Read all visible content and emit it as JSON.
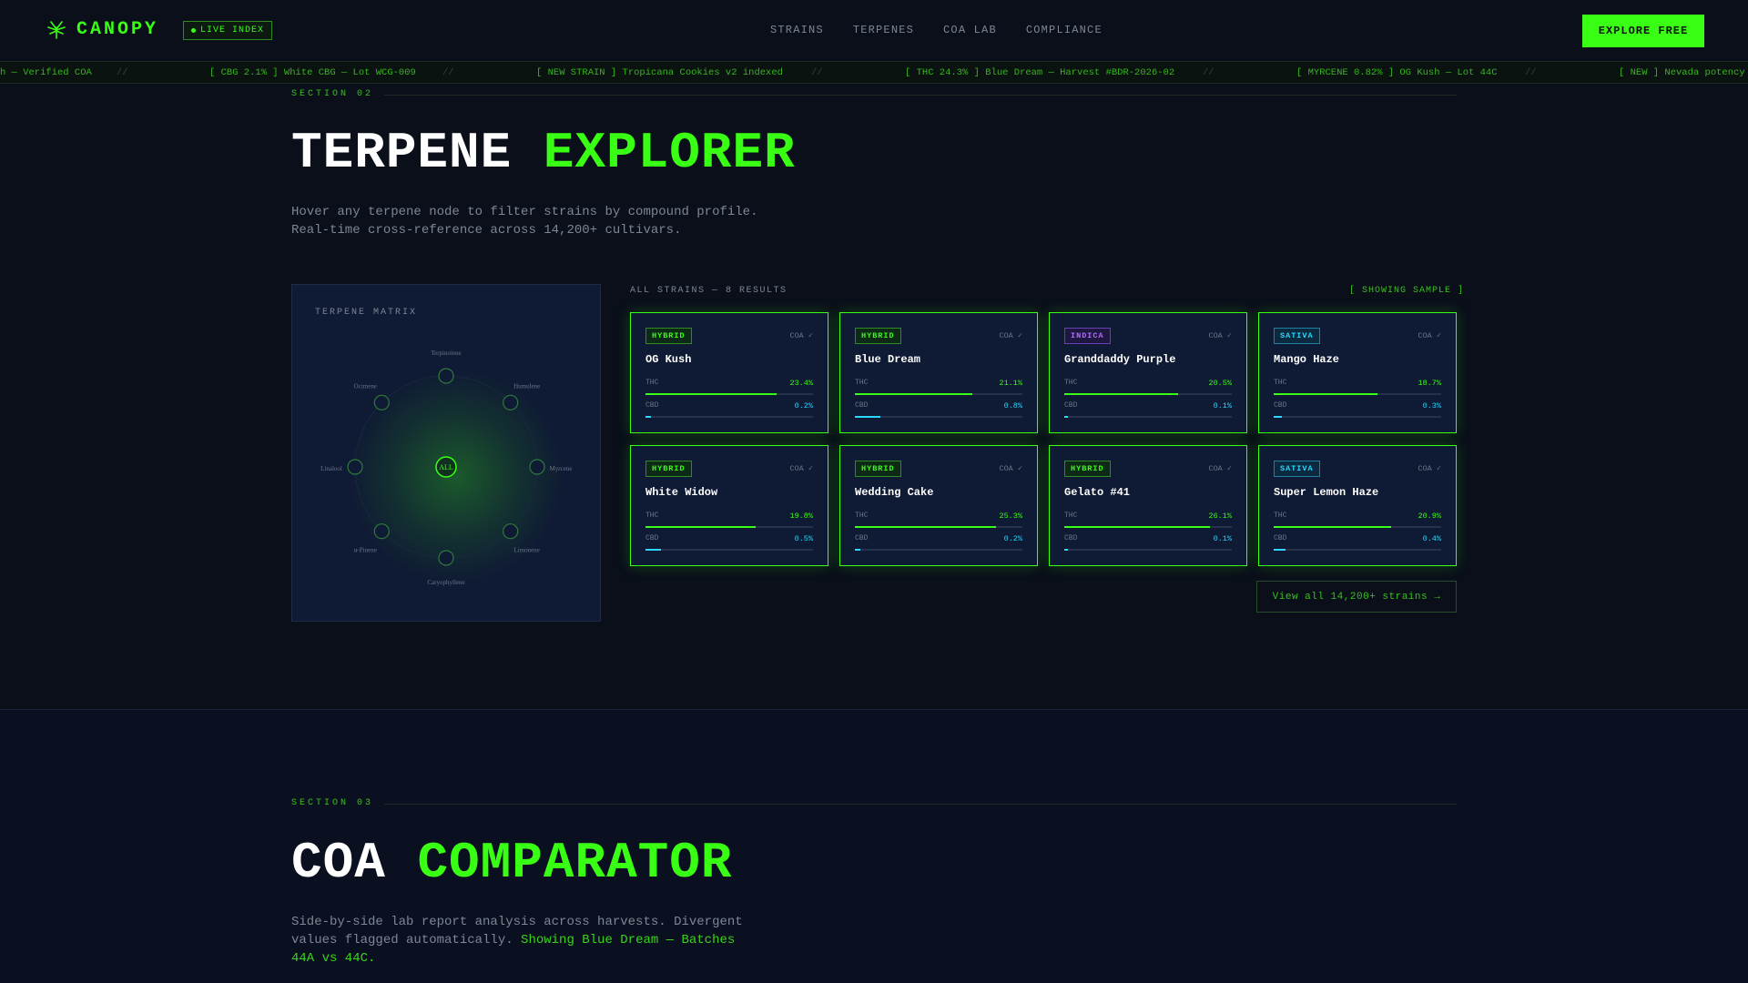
{
  "nav": {
    "logo_text": "CANOPY",
    "logo_icon": "hemp-leaf-icon",
    "live_badge": "LIVE INDEX",
    "links": [
      "STRAINS",
      "TERPENES",
      "COA LAB",
      "COMPLIANCE"
    ],
    "cta": "EXPLORE FREE"
  },
  "ticker": {
    "items": [
      "h — Verified COA",
      "[ CBG 2.1% ] White CBG — Lot WCG-009",
      "[ NEW STRAIN ] Tropicana Cookies v2 indexed",
      "[ THC 24.3% ] Blue Dream — Harvest #BDR-2026-02",
      "[ MYRCENE 0.82% ] OG Kush — Lot 44C",
      "[ NEW ] Nevada potency"
    ],
    "separator": "//"
  },
  "section2": {
    "label": "SECTION 02",
    "title_main": "TERPENE",
    "title_accent": "EXPLORER",
    "description": "Hover any terpene node to filter strains by compound profile. Real-time cross-reference across 14,200+ cultivars."
  },
  "matrix": {
    "title": "TERPENE MATRIX",
    "center_label": "ALL",
    "nodes": [
      "Terpinolene",
      "Humulene",
      "Myrcene",
      "Limonene",
      "Caryophyllene",
      "α-Pinene",
      "Linalool",
      "Ocimene"
    ]
  },
  "results": {
    "heading": "ALL STRAINS — 8 RESULTS",
    "sample_label": "[ SHOWING SAMPLE ]",
    "thc_label": "THC",
    "cbd_label": "CBD",
    "coa_label": "COA ✓",
    "cards": [
      {
        "type": "HYBRID",
        "kind": "hybrid",
        "name": "OG Kush",
        "thc": "23.4%",
        "cbd": "0.2%",
        "thc_pct": 78,
        "cbd_pct": 3
      },
      {
        "type": "HYBRID",
        "kind": "hybrid",
        "name": "Blue Dream",
        "thc": "21.1%",
        "cbd": "0.8%",
        "thc_pct": 70,
        "cbd_pct": 15
      },
      {
        "type": "INDICA",
        "kind": "indica",
        "name": "Granddaddy Purple",
        "thc": "20.5%",
        "cbd": "0.1%",
        "thc_pct": 68,
        "cbd_pct": 2
      },
      {
        "type": "SATIVA",
        "kind": "sativa",
        "name": "Mango Haze",
        "thc": "18.7%",
        "cbd": "0.3%",
        "thc_pct": 62,
        "cbd_pct": 5
      },
      {
        "type": "HYBRID",
        "kind": "hybrid",
        "name": "White Widow",
        "thc": "19.8%",
        "cbd": "0.5%",
        "thc_pct": 66,
        "cbd_pct": 9
      },
      {
        "type": "HYBRID",
        "kind": "hybrid",
        "name": "Wedding Cake",
        "thc": "25.3%",
        "cbd": "0.2%",
        "thc_pct": 84,
        "cbd_pct": 3
      },
      {
        "type": "HYBRID",
        "kind": "hybrid",
        "name": "Gelato #41",
        "thc": "26.1%",
        "cbd": "0.1%",
        "thc_pct": 87,
        "cbd_pct": 2
      },
      {
        "type": "SATIVA",
        "kind": "sativa",
        "name": "Super Lemon Haze",
        "thc": "20.9%",
        "cbd": "0.4%",
        "thc_pct": 70,
        "cbd_pct": 7
      }
    ],
    "view_all": "View all 14,200+ strains →"
  },
  "section3": {
    "label": "SECTION 03",
    "title_main": "COA",
    "title_accent": "COMPARATOR",
    "description": "Side-by-side lab report analysis across harvests. Divergent values flagged automatically.",
    "highlight": "Showing Blue Dream — Batches 44A vs 44C."
  },
  "colors": {
    "accent": "#39ff14",
    "background": "#0a0f1a",
    "card": "#0f1a34",
    "cbd": "#2ad7ff",
    "indica": "#b06cff"
  }
}
